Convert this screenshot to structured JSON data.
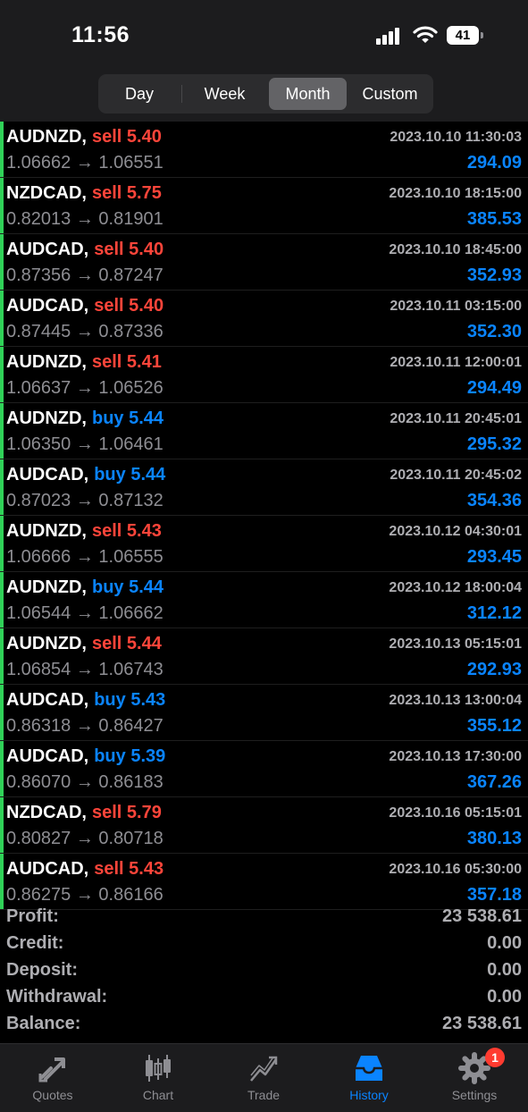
{
  "status": {
    "time": "11:56",
    "battery": "41"
  },
  "segments": [
    "Day",
    "Week",
    "Month",
    "Custom"
  ],
  "selected_segment": "Month",
  "arrow": "→",
  "trades": [
    {
      "symbol": "AUDNZD,",
      "side": "sell",
      "lots": "5.40",
      "open": "1.06662",
      "close": "1.06551",
      "time": "2023.10.10 11:30:03",
      "profit": "294.09"
    },
    {
      "symbol": "NZDCAD,",
      "side": "sell",
      "lots": "5.75",
      "open": "0.82013",
      "close": "0.81901",
      "time": "2023.10.10 18:15:00",
      "profit": "385.53"
    },
    {
      "symbol": "AUDCAD,",
      "side": "sell",
      "lots": "5.40",
      "open": "0.87356",
      "close": "0.87247",
      "time": "2023.10.10 18:45:00",
      "profit": "352.93"
    },
    {
      "symbol": "AUDCAD,",
      "side": "sell",
      "lots": "5.40",
      "open": "0.87445",
      "close": "0.87336",
      "time": "2023.10.11 03:15:00",
      "profit": "352.30"
    },
    {
      "symbol": "AUDNZD,",
      "side": "sell",
      "lots": "5.41",
      "open": "1.06637",
      "close": "1.06526",
      "time": "2023.10.11 12:00:01",
      "profit": "294.49"
    },
    {
      "symbol": "AUDNZD,",
      "side": "buy",
      "lots": "5.44",
      "open": "1.06350",
      "close": "1.06461",
      "time": "2023.10.11 20:45:01",
      "profit": "295.32"
    },
    {
      "symbol": "AUDCAD,",
      "side": "buy",
      "lots": "5.44",
      "open": "0.87023",
      "close": "0.87132",
      "time": "2023.10.11 20:45:02",
      "profit": "354.36"
    },
    {
      "symbol": "AUDNZD,",
      "side": "sell",
      "lots": "5.43",
      "open": "1.06666",
      "close": "1.06555",
      "time": "2023.10.12 04:30:01",
      "profit": "293.45"
    },
    {
      "symbol": "AUDNZD,",
      "side": "buy",
      "lots": "5.44",
      "open": "1.06544",
      "close": "1.06662",
      "time": "2023.10.12 18:00:04",
      "profit": "312.12"
    },
    {
      "symbol": "AUDNZD,",
      "side": "sell",
      "lots": "5.44",
      "open": "1.06854",
      "close": "1.06743",
      "time": "2023.10.13 05:15:01",
      "profit": "292.93"
    },
    {
      "symbol": "AUDCAD,",
      "side": "buy",
      "lots": "5.43",
      "open": "0.86318",
      "close": "0.86427",
      "time": "2023.10.13 13:00:04",
      "profit": "355.12"
    },
    {
      "symbol": "AUDCAD,",
      "side": "buy",
      "lots": "5.39",
      "open": "0.86070",
      "close": "0.86183",
      "time": "2023.10.13 17:30:00",
      "profit": "367.26"
    },
    {
      "symbol": "NZDCAD,",
      "side": "sell",
      "lots": "5.79",
      "open": "0.80827",
      "close": "0.80718",
      "time": "2023.10.16 05:15:01",
      "profit": "380.13"
    },
    {
      "symbol": "AUDCAD,",
      "side": "sell",
      "lots": "5.43",
      "open": "0.86275",
      "close": "0.86166",
      "time": "2023.10.16 05:30:00",
      "profit": "357.18"
    }
  ],
  "summary": [
    {
      "label": "Profit:",
      "value": "23 538.61"
    },
    {
      "label": "Credit:",
      "value": "0.00"
    },
    {
      "label": "Deposit:",
      "value": "0.00"
    },
    {
      "label": "Withdrawal:",
      "value": "0.00"
    },
    {
      "label": "Balance:",
      "value": "23 538.61"
    }
  ],
  "tabs": [
    {
      "label": "Quotes",
      "icon": "quotes-icon"
    },
    {
      "label": "Chart",
      "icon": "chart-icon"
    },
    {
      "label": "Trade",
      "icon": "trade-icon"
    },
    {
      "label": "History",
      "icon": "history-icon"
    },
    {
      "label": "Settings",
      "icon": "settings-icon"
    }
  ],
  "active_tab": "History",
  "settings_badge": "1",
  "colors": {
    "sell": "#ff453a",
    "buy": "#0a84ff",
    "profit": "#0a84ff",
    "row_marker": "#30d158",
    "accent": "#0a84ff"
  }
}
